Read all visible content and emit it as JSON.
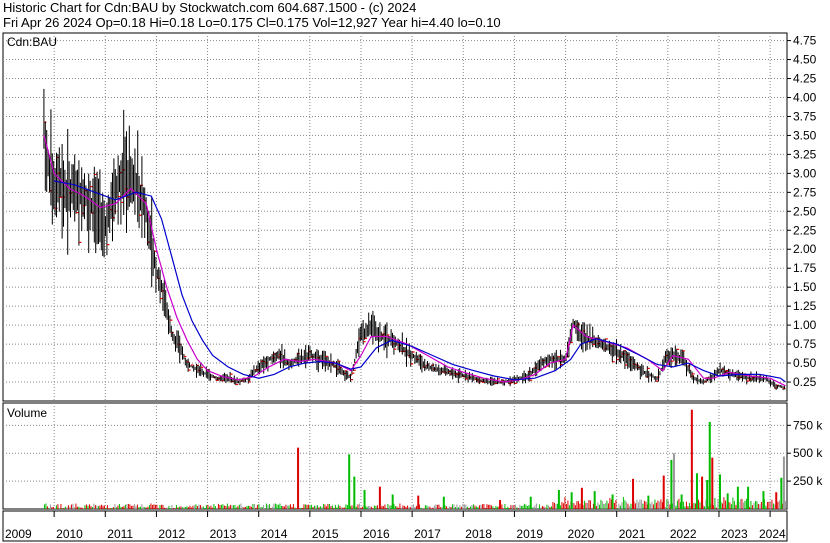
{
  "header": {
    "line1": "Historic Chart for Cdn:BAU by Stockwatch.com 604.687.1500 - (c) 2024",
    "line2": "Fri Apr 26 2024   Op=0.18  Hi=0.18  Lo=0.175  Cl=0.175  Vol=12,927  Year hi=4.40  lo=0.10"
  },
  "chart_data": [
    {
      "type": "bar",
      "title": "Cdn:BAU",
      "subtype": "price-range-bars with moving averages",
      "ylim": [
        0.0,
        4.85
      ],
      "y_ticks": [
        "4.75",
        "4.50",
        "4.25",
        "4.00",
        "3.75",
        "3.50",
        "3.25",
        "3.00",
        "2.75",
        "2.50",
        "2.25",
        "2.00",
        "1.75",
        "1.50",
        "1.25",
        "1.00",
        "0.75",
        "0.50",
        "0.25"
      ],
      "y_tick_values": [
        4.75,
        4.5,
        4.25,
        4.0,
        3.75,
        3.5,
        3.25,
        3.0,
        2.75,
        2.5,
        2.25,
        2.0,
        1.75,
        1.5,
        1.25,
        1.0,
        0.75,
        0.5,
        0.25
      ],
      "grid": true,
      "colors": {
        "bars": "#000000",
        "close_marks": "#dd0000",
        "ma_short": "#cc00cc",
        "ma_long": "#0000cc"
      },
      "series": [
        {
          "role": "price-close",
          "x": [
            2009.8,
            2009.9,
            2010.0,
            2010.1,
            2010.3,
            2010.5,
            2010.7,
            2010.9,
            2011.0,
            2011.2,
            2011.4,
            2011.6,
            2011.8,
            2011.9,
            2012.0,
            2012.1,
            2012.2,
            2012.3,
            2012.45,
            2012.6,
            2012.8,
            2013.0,
            2013.2,
            2013.4,
            2013.6,
            2013.8,
            2014.0,
            2014.2,
            2014.4,
            2014.6,
            2014.8,
            2015.0,
            2015.2,
            2015.4,
            2015.6,
            2015.8,
            2016.0,
            2016.2,
            2016.4,
            2016.6,
            2016.8,
            2017.0,
            2017.3,
            2017.6,
            2017.9,
            2018.2,
            2018.5,
            2018.8,
            2019.1,
            2019.3,
            2019.5,
            2019.7,
            2019.85,
            2020.0,
            2020.15,
            2020.3,
            2020.5,
            2020.7,
            2021.0,
            2021.3,
            2021.6,
            2021.8,
            2021.95,
            2022.1,
            2022.3,
            2022.5,
            2022.7,
            2022.85,
            2023.0,
            2023.3,
            2023.6,
            2023.9,
            2024.1,
            2024.3
          ],
          "y": [
            3.6,
            3.0,
            2.8,
            2.9,
            2.7,
            2.8,
            2.6,
            2.5,
            2.3,
            2.8,
            3.0,
            2.9,
            2.5,
            2.1,
            1.7,
            1.5,
            1.2,
            0.9,
            0.7,
            0.5,
            0.4,
            0.35,
            0.3,
            0.3,
            0.25,
            0.3,
            0.45,
            0.55,
            0.6,
            0.5,
            0.55,
            0.6,
            0.55,
            0.5,
            0.4,
            0.3,
            0.9,
            0.95,
            0.85,
            0.8,
            0.7,
            0.6,
            0.45,
            0.4,
            0.35,
            0.3,
            0.25,
            0.25,
            0.3,
            0.35,
            0.5,
            0.55,
            0.55,
            0.55,
            1.05,
            0.85,
            0.8,
            0.75,
            0.65,
            0.5,
            0.35,
            0.3,
            0.55,
            0.6,
            0.55,
            0.3,
            0.25,
            0.3,
            0.4,
            0.35,
            0.3,
            0.3,
            0.2,
            0.175
          ]
        },
        {
          "role": "ma-short",
          "x": [
            2009.8,
            2010.0,
            2010.3,
            2010.6,
            2010.9,
            2011.2,
            2011.5,
            2011.8,
            2012.0,
            2012.2,
            2012.4,
            2012.6,
            2012.8,
            2013.0,
            2013.3,
            2013.6,
            2013.9,
            2014.2,
            2014.5,
            2014.8,
            2015.1,
            2015.5,
            2015.8,
            2016.0,
            2016.2,
            2016.5,
            2016.9,
            2017.3,
            2017.7,
            2018.0,
            2018.4,
            2018.8,
            2019.1,
            2019.4,
            2019.7,
            2020.0,
            2020.15,
            2020.4,
            2020.8,
            2021.2,
            2021.6,
            2021.9,
            2022.1,
            2022.4,
            2022.7,
            2022.9,
            2023.2,
            2023.6,
            2024.0,
            2024.3
          ],
          "y": [
            3.5,
            3.0,
            2.8,
            2.7,
            2.55,
            2.6,
            2.8,
            2.6,
            2.0,
            1.5,
            1.1,
            0.8,
            0.55,
            0.4,
            0.32,
            0.28,
            0.32,
            0.45,
            0.55,
            0.52,
            0.55,
            0.5,
            0.4,
            0.6,
            0.85,
            0.85,
            0.75,
            0.6,
            0.45,
            0.38,
            0.3,
            0.25,
            0.28,
            0.35,
            0.5,
            0.55,
            1.0,
            0.85,
            0.78,
            0.7,
            0.55,
            0.4,
            0.6,
            0.55,
            0.3,
            0.3,
            0.38,
            0.33,
            0.3,
            0.2
          ]
        },
        {
          "role": "ma-long",
          "x": [
            2010.0,
            2010.4,
            2010.8,
            2011.2,
            2011.6,
            2011.9,
            2012.1,
            2012.3,
            2012.5,
            2012.7,
            2012.9,
            2013.1,
            2013.4,
            2013.7,
            2014.0,
            2014.3,
            2014.6,
            2014.9,
            2015.2,
            2015.5,
            2015.8,
            2016.0,
            2016.3,
            2016.6,
            2017.0,
            2017.4,
            2017.8,
            2018.2,
            2018.6,
            2019.0,
            2019.4,
            2019.8,
            2020.1,
            2020.3,
            2020.6,
            2021.0,
            2021.4,
            2021.8,
            2022.1,
            2022.4,
            2022.7,
            2023.0,
            2023.4,
            2023.8,
            2024.2,
            2024.3
          ],
          "y": [
            2.9,
            2.85,
            2.75,
            2.65,
            2.75,
            2.7,
            2.4,
            1.9,
            1.4,
            1.05,
            0.8,
            0.6,
            0.45,
            0.35,
            0.3,
            0.35,
            0.45,
            0.5,
            0.52,
            0.5,
            0.42,
            0.45,
            0.7,
            0.8,
            0.72,
            0.6,
            0.48,
            0.4,
            0.33,
            0.28,
            0.3,
            0.4,
            0.55,
            0.75,
            0.82,
            0.75,
            0.62,
            0.48,
            0.45,
            0.5,
            0.4,
            0.33,
            0.35,
            0.35,
            0.3,
            0.25
          ]
        }
      ]
    },
    {
      "type": "bar",
      "title": "Volume",
      "ylim": [
        0,
        950000
      ],
      "y_ticks": [
        "750 k",
        "500 k",
        "250 k"
      ],
      "y_tick_values": [
        750000,
        500000,
        250000
      ],
      "grid": true,
      "colors": {
        "up": "#00bb00",
        "down": "#dd0000",
        "neutral": "#999999"
      },
      "bars": [
        {
          "x": 2014.75,
          "v": 550000,
          "c": "down"
        },
        {
          "x": 2015.75,
          "v": 490000,
          "c": "up"
        },
        {
          "x": 2015.85,
          "v": 290000,
          "c": "up"
        },
        {
          "x": 2016.05,
          "v": 170000,
          "c": "up"
        },
        {
          "x": 2016.35,
          "v": 200000,
          "c": "down"
        },
        {
          "x": 2016.6,
          "v": 130000,
          "c": "up"
        },
        {
          "x": 2017.1,
          "v": 120000,
          "c": "down"
        },
        {
          "x": 2017.6,
          "v": 110000,
          "c": "up"
        },
        {
          "x": 2018.7,
          "v": 80000,
          "c": "down"
        },
        {
          "x": 2019.3,
          "v": 110000,
          "c": "up"
        },
        {
          "x": 2019.85,
          "v": 170000,
          "c": "up"
        },
        {
          "x": 2020.1,
          "v": 150000,
          "c": "up"
        },
        {
          "x": 2020.3,
          "v": 190000,
          "c": "down"
        },
        {
          "x": 2020.55,
          "v": 160000,
          "c": "up"
        },
        {
          "x": 2020.9,
          "v": 130000,
          "c": "up"
        },
        {
          "x": 2021.3,
          "v": 270000,
          "c": "down"
        },
        {
          "x": 2021.6,
          "v": 120000,
          "c": "up"
        },
        {
          "x": 2021.9,
          "v": 300000,
          "c": "down"
        },
        {
          "x": 2022.05,
          "v": 440000,
          "c": "up"
        },
        {
          "x": 2022.1,
          "v": 500000,
          "c": "neutral"
        },
        {
          "x": 2022.25,
          "v": 130000,
          "c": "up"
        },
        {
          "x": 2022.45,
          "v": 890000,
          "c": "down"
        },
        {
          "x": 2022.55,
          "v": 320000,
          "c": "up"
        },
        {
          "x": 2022.65,
          "v": 290000,
          "c": "down"
        },
        {
          "x": 2022.75,
          "v": 260000,
          "c": "up"
        },
        {
          "x": 2022.8,
          "v": 780000,
          "c": "up"
        },
        {
          "x": 2022.85,
          "v": 460000,
          "c": "down"
        },
        {
          "x": 2023.0,
          "v": 310000,
          "c": "up"
        },
        {
          "x": 2023.15,
          "v": 140000,
          "c": "up"
        },
        {
          "x": 2023.35,
          "v": 200000,
          "c": "up"
        },
        {
          "x": 2023.55,
          "v": 200000,
          "c": "up"
        },
        {
          "x": 2023.85,
          "v": 160000,
          "c": "up"
        },
        {
          "x": 2024.1,
          "v": 150000,
          "c": "down"
        },
        {
          "x": 2024.2,
          "v": 280000,
          "c": "up"
        },
        {
          "x": 2024.25,
          "v": 470000,
          "c": "neutral"
        }
      ]
    }
  ],
  "x_axis": {
    "ticks": [
      "2009",
      "2010",
      "2011",
      "2012",
      "2013",
      "2014",
      "2015",
      "2016",
      "2017",
      "2018",
      "2019",
      "2020",
      "2021",
      "2022",
      "2023",
      "2024"
    ],
    "tick_values": [
      2009,
      2010,
      2011,
      2012,
      2013,
      2014,
      2015,
      2016,
      2017,
      2018,
      2019,
      2020,
      2021,
      2022,
      2023,
      2024
    ],
    "range": [
      2009.0,
      2024.33
    ]
  }
}
